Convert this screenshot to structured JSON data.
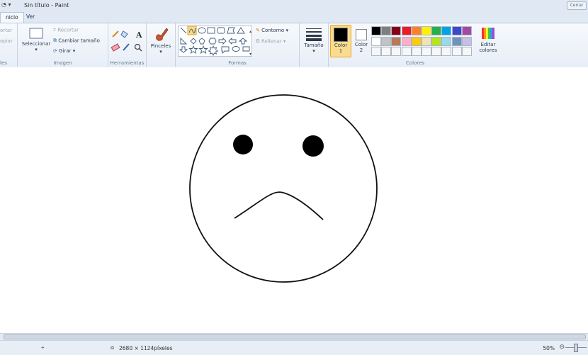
{
  "window": {
    "title": "Sin título - Paint",
    "window_button_label": "Cerrar"
  },
  "tabs": [
    {
      "label": "Inicio",
      "visible_label": "nicio"
    },
    {
      "label": "Ver"
    }
  ],
  "ribbon": {
    "portapapeles": {
      "cortar_partial": "ortar",
      "copiar_partial": "opiar",
      "group_partial": "les"
    },
    "imagen": {
      "seleccionar": "Seleccionar",
      "recortar": "Recortar",
      "cambiar_tamano": "Cambiar tamaño",
      "girar": "Girar",
      "group": "Imagen"
    },
    "herramientas": {
      "group": "Herramientas"
    },
    "pinceles": {
      "label": "Pinceles"
    },
    "formas": {
      "contorno": "Contorno",
      "relleno": "Rellenar",
      "group": "Formas"
    },
    "tamano": {
      "label": "Tamaño"
    },
    "colores": {
      "color1_l1": "Color",
      "color1_l2": "1",
      "color2_l1": "Color",
      "color2_l2": "2",
      "editar_l1": "Editar",
      "editar_l2": "colores",
      "group": "Colores",
      "color1": "#000000",
      "color2": "#ffffff",
      "palette_row1": [
        "#000000",
        "#7f7f7f",
        "#880015",
        "#ed1c24",
        "#ff7f27",
        "#fff200",
        "#22b14c",
        "#00a2e8",
        "#3f48cc",
        "#a349a4"
      ],
      "palette_row2": [
        "#ffffff",
        "#c3c3c3",
        "#b97a57",
        "#ffaec9",
        "#ffc90e",
        "#efe4b0",
        "#b5e61d",
        "#99d9ea",
        "#7092be",
        "#c8bfe7"
      ]
    }
  },
  "status": {
    "canvas_size": "2680 × 1124píxeles",
    "zoom": "50%"
  }
}
